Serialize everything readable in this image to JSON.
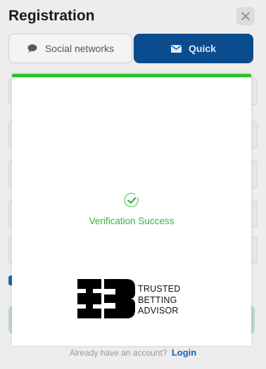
{
  "registration": {
    "title": "Registration",
    "tabs": [
      {
        "label": "Social networks",
        "icon": "chat-bubble-icon",
        "active": false
      },
      {
        "label": "Quick",
        "icon": "envelope-icon",
        "active": true
      }
    ],
    "footer": {
      "prompt": "Already have an account?",
      "login_label": "Login"
    }
  },
  "modal": {
    "status_text": "Verification Success",
    "status_icon": "check-circle-icon",
    "accent_color": "#2fc12f",
    "provider_logo": {
      "lines": [
        "TRUSTED",
        "BETTING",
        "ADVISOR"
      ]
    }
  },
  "colors": {
    "brand_blue": "#0b4c8f",
    "success_green": "#34b53a",
    "link_blue": "#1a63b8"
  }
}
